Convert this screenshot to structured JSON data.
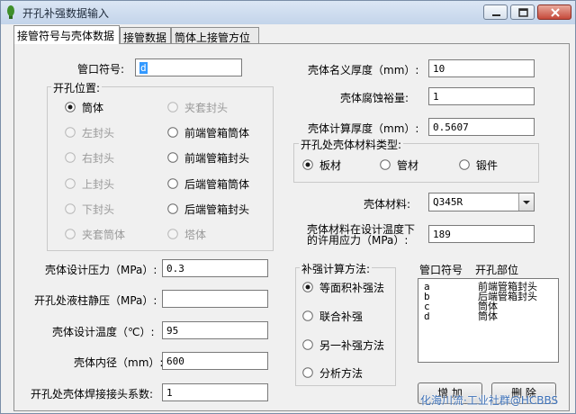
{
  "window": {
    "title": "开孔补强数据输入",
    "controls": {
      "minimize": "minimize",
      "maximize": "maximize",
      "close": "close"
    }
  },
  "tabs": [
    {
      "label": "接管符号与壳体数据",
      "active": true
    },
    {
      "label": "接管数据",
      "active": false
    },
    {
      "label": "筒体上接管方位",
      "active": false
    }
  ],
  "nozzle_symbol": {
    "label": "管口符号:",
    "value": "d"
  },
  "opening_position": {
    "title": "开孔位置:",
    "options": [
      {
        "label": "筒体",
        "checked": true,
        "enabled": true
      },
      {
        "label": "夹套封头",
        "checked": false,
        "enabled": false
      },
      {
        "label": "左封头",
        "checked": false,
        "enabled": false
      },
      {
        "label": "前端管箱筒体",
        "checked": false,
        "enabled": true
      },
      {
        "label": "右封头",
        "checked": false,
        "enabled": false
      },
      {
        "label": "前端管箱封头",
        "checked": false,
        "enabled": true
      },
      {
        "label": "上封头",
        "checked": false,
        "enabled": false
      },
      {
        "label": "后端管箱筒体",
        "checked": false,
        "enabled": true
      },
      {
        "label": "下封头",
        "checked": false,
        "enabled": false
      },
      {
        "label": "后端管箱封头",
        "checked": false,
        "enabled": true
      },
      {
        "label": "夹套筒体",
        "checked": false,
        "enabled": false
      },
      {
        "label": "塔体",
        "checked": false,
        "enabled": false
      }
    ]
  },
  "shell": {
    "nominal_thickness": {
      "label": "壳体名义厚度（mm）:",
      "value": "10"
    },
    "corrosion_allowance": {
      "label": "壳体腐蚀裕量:",
      "value": "1"
    },
    "calc_thickness": {
      "label": "壳体计算厚度（mm）:",
      "value": "0.5607"
    },
    "material": {
      "label": "壳体材料:",
      "value": "Q345R"
    },
    "allowable_stress": {
      "label_line1": "壳体材料在设计温度下",
      "label_line2": "的许用应力（MPa）:",
      "value": "189"
    }
  },
  "material_type": {
    "title": "开孔处壳体材料类型:",
    "options": [
      {
        "label": "板材",
        "checked": true
      },
      {
        "label": "管材",
        "checked": false
      },
      {
        "label": "锻件",
        "checked": false
      }
    ]
  },
  "design": {
    "pressure": {
      "label": "壳体设计压力（MPa）:",
      "value": "0.3"
    },
    "liquid_pressure": {
      "label": "开孔处液柱静压（MPa）:",
      "value": ""
    },
    "temperature": {
      "label": "壳体设计温度（℃）:",
      "value": "95"
    },
    "inner_diameter": {
      "label": "壳体内径（mm）:",
      "value": "600"
    },
    "joint_coefficient": {
      "label": "开孔处壳体焊接接头系数:",
      "value": "1"
    }
  },
  "reinforce_method": {
    "title": "补强计算方法:",
    "options": [
      {
        "label": "等面积补强法",
        "checked": true
      },
      {
        "label": "联合补强",
        "checked": false
      },
      {
        "label": "另一补强方法",
        "checked": false
      },
      {
        "label": "分析方法",
        "checked": false
      }
    ]
  },
  "nozzle_list": {
    "header_symbol": "管口符号",
    "header_position": "开孔部位",
    "rows": [
      {
        "symbol": "a",
        "position": "前端管箱封头"
      },
      {
        "symbol": "b",
        "position": "后端管箱封头"
      },
      {
        "symbol": "c",
        "position": "筒体"
      },
      {
        "symbol": "d",
        "position": "筒体"
      }
    ]
  },
  "buttons": {
    "add": "增 加",
    "delete": "删 除"
  },
  "watermark": "化海川流·工业社群@HCBBS"
}
